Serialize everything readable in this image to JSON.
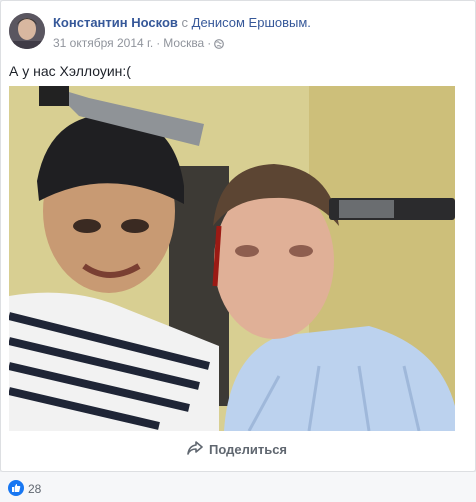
{
  "post": {
    "author": "Константин Носков",
    "with_word": "с",
    "tagged_user": "Денисом Ершовым.",
    "date": "31 октября 2014 г.",
    "separator": "·",
    "location": "Москва",
    "separator2": "·",
    "privacy_icon": "globe-icon",
    "text": "А у нас Хэллоуин:("
  },
  "actions": {
    "share_label": "Поделиться"
  },
  "reactions": {
    "like_icon": "like-icon",
    "count": "28"
  },
  "colors": {
    "link": "#365899",
    "meta": "#90949c",
    "like_blue": "#1877f2",
    "page_bg": "#e9ebee"
  }
}
